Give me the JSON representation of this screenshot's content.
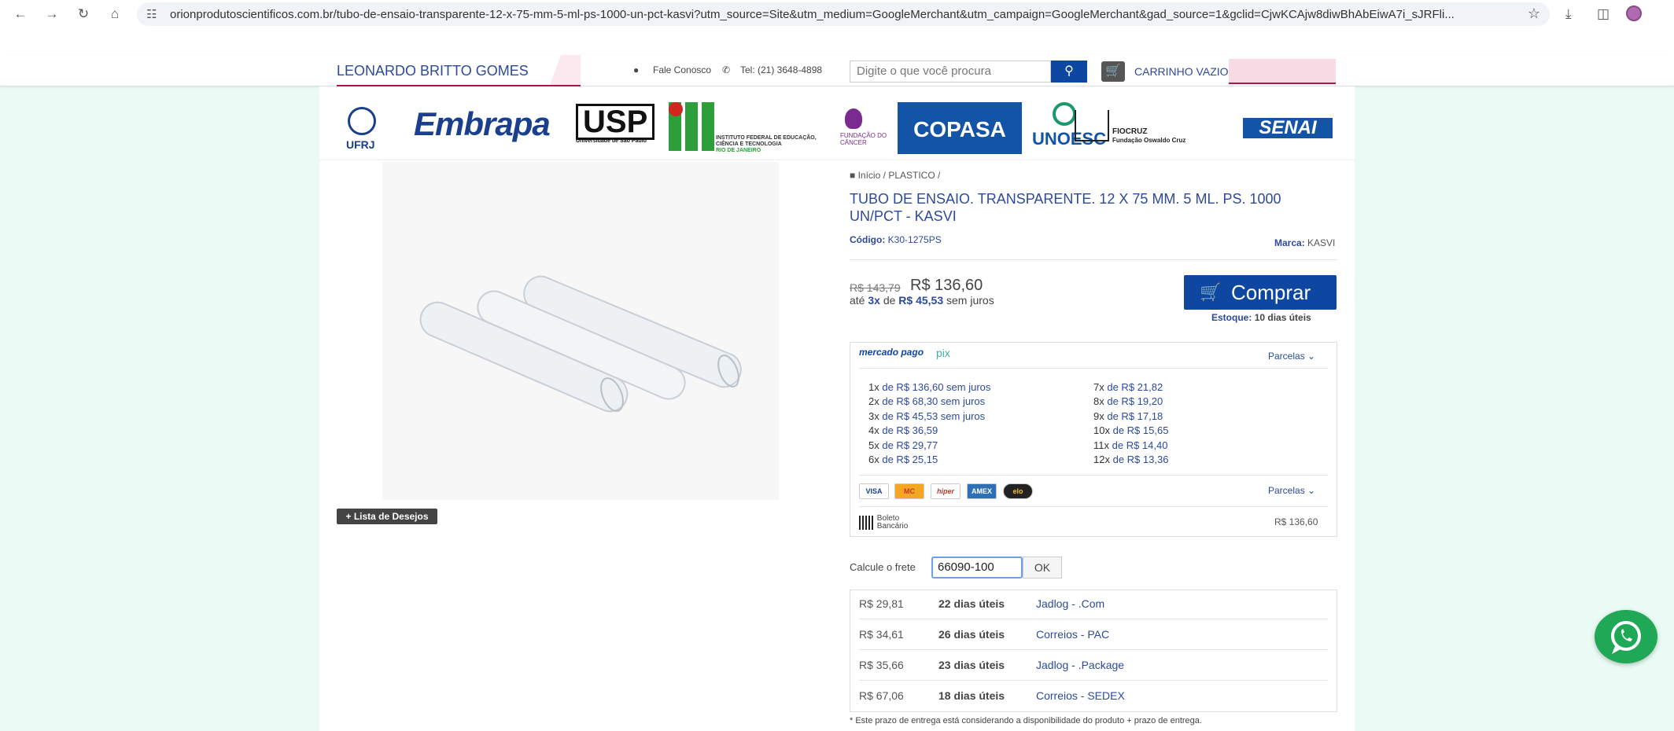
{
  "browser": {
    "url": "orionprodutoscientificos.com.br/tubo-de-ensaio-transparente-12-x-75-mm-5-ml-ps-1000-un-pct-kasvi?utm_source=Site&utm_medium=GoogleMerchant&utm_campaign=GoogleMerchant&gad_source=1&gclid=CjwKCAjw8diwBhAbEiwA7i_sJRFli..."
  },
  "header": {
    "store_name": "LEONARDO BRITTO GOMES",
    "contact_label": "Fale Conosco",
    "phone": "Tel: (21) 3648-4898",
    "search_placeholder": "Digite o que você procura",
    "cart_label": "CARRINHO VAZIO"
  },
  "logos": {
    "ufrj": "UFRJ",
    "embrapa": "Embrapa",
    "usp": "USP",
    "usp_sub": "Universidade de São Paulo",
    "ifrj": "INSTITUTO FEDERAL DE EDUCAÇÃO, CIÊNCIA E TECNOLOGIA",
    "ifrj_sub": "RIO DE JANEIRO",
    "fundacao_cancer": "FUNDAÇÃO DO CÂNCER",
    "copasa": "COPASA",
    "unoesc": "UNOESC",
    "fiocruz": "FIOCRUZ",
    "fiocruz_sub": "Fundação Oswaldo Cruz",
    "senai": "SENAI"
  },
  "breadcrumb": {
    "home": "Início",
    "sep1": "/",
    "category": "PLASTICO",
    "sep2": "/"
  },
  "product": {
    "title": "TUBO DE ENSAIO. TRANSPARENTE. 12 X 75 MM. 5 ML. PS. 1000 UN/PCT - KASVI",
    "code_label": "Código:",
    "code": "K30-1275PS",
    "brand_label": "Marca:",
    "brand": "KASVI",
    "old_price": "R$ 143,79",
    "price": "R$ 136,60",
    "installment_prefix": "até",
    "installment_count": "3x",
    "installment_mid": "de",
    "installment_value": "R$ 45,53",
    "installment_suffix": "sem juros",
    "buy_label": "Comprar",
    "stock_label": "Estoque:",
    "stock_value": "10 dias úteis",
    "wishlist": "Lista de Desejos"
  },
  "payment": {
    "mp_brand": "mercado pago",
    "pix": "pix",
    "parcelas_label": "Parcelas",
    "installments": [
      {
        "n": "1x",
        "text": "de R$ 136,60 sem juros"
      },
      {
        "n": "2x",
        "text": "de R$ 68,30 sem juros"
      },
      {
        "n": "3x",
        "text": "de R$ 45,53 sem juros"
      },
      {
        "n": "4x",
        "text": "de R$ 36,59"
      },
      {
        "n": "5x",
        "text": "de R$ 29,77"
      },
      {
        "n": "6x",
        "text": "de R$ 25,15"
      },
      {
        "n": "7x",
        "text": "de R$ 21,82"
      },
      {
        "n": "8x",
        "text": "de R$ 19,20"
      },
      {
        "n": "9x",
        "text": "de R$ 17,18"
      },
      {
        "n": "10x",
        "text": "de R$ 15,65"
      },
      {
        "n": "11x",
        "text": "de R$ 14,40"
      },
      {
        "n": "12x",
        "text": "de R$ 13,36"
      }
    ],
    "cards": [
      "VISA",
      "MC",
      "hiper",
      "AMEX",
      "elo"
    ],
    "boleto_label": "Boleto Bancário",
    "boleto_value": "R$ 136,60"
  },
  "shipping": {
    "label": "Calcule o frete",
    "cep_value": "66090-100",
    "ok_label": "OK",
    "options": [
      {
        "price": "R$ 29,81",
        "days": "22 dias úteis",
        "carrier": "Jadlog - .Com"
      },
      {
        "price": "R$ 34,61",
        "days": "26 dias úteis",
        "carrier": "Correios - PAC"
      },
      {
        "price": "R$ 35,66",
        "days": "23 dias úteis",
        "carrier": "Jadlog - .Package"
      },
      {
        "price": "R$ 67,06",
        "days": "18 dias úteis",
        "carrier": "Correios - SEDEX"
      }
    ],
    "note": "* Este prazo de entrega está considerando a disponibilidade do produto + prazo de entrega."
  }
}
